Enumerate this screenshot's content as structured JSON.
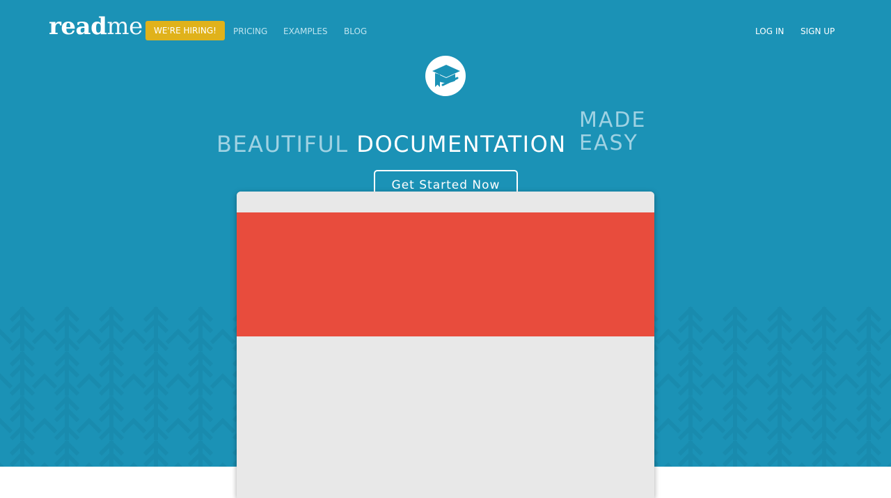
{
  "brand": {
    "logo_bold": "read",
    "logo_light": "me"
  },
  "nav": {
    "hiring_label": "WE'RE HIRING!",
    "links": [
      "PRICING",
      "EXAMPLES",
      "BLOG"
    ],
    "login_label": "LOG IN",
    "signup_label": "SIGN UP"
  },
  "hero": {
    "badge_icon": "graduation-cap-book-icon",
    "headline_light": "BEAUTIFUL",
    "headline_strong": "DOCUMENTATION",
    "made": "MADE",
    "easy": "EASY",
    "cta_label": "Get Started Now"
  },
  "colors": {
    "hero_bg": "#1b92b6",
    "hiring_bg": "#e0b21b",
    "preview_banner": "#e84c3d",
    "preview_body": "#e8e8e8"
  }
}
